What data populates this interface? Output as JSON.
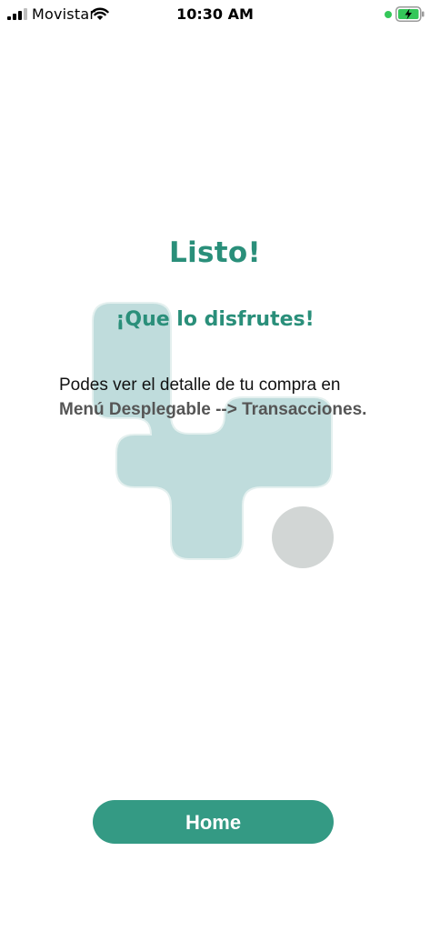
{
  "status_bar": {
    "carrier": "Movistar",
    "time": "10:30 AM",
    "icons": [
      "signal-icon",
      "wifi-icon",
      "charging-dot",
      "battery-charging-icon"
    ]
  },
  "main": {
    "title": "Listo!",
    "subtitle": "¡Que lo disfrutes!",
    "message_line1": "Podes ver el detalle de tu compra en",
    "message_line2": "Menú Desplegable --> Transacciones."
  },
  "home_button": {
    "label": "Home"
  },
  "colors": {
    "accent": "#2a8f7a",
    "button": "#349a84",
    "shape_teal": "#bfdcdc",
    "shape_gray": "#d2d6d5",
    "charging_green": "#34c759"
  }
}
